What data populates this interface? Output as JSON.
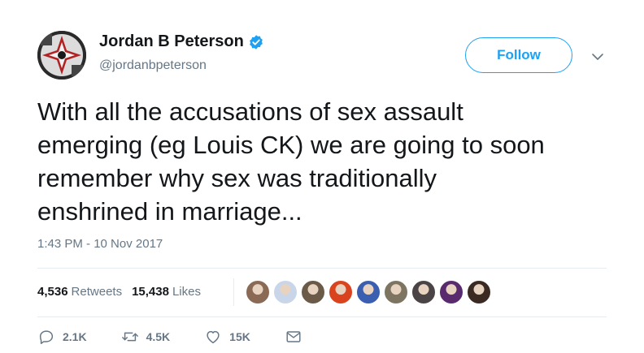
{
  "author": {
    "name": "Jordan B Peterson",
    "handle": "@jordanbpeterson",
    "verified": true,
    "avatar_icon": "mandala-avatar"
  },
  "follow_label": "Follow",
  "tweet": {
    "text": "With all the accusations of sex assault\nemerging (eg Louis CK) we are going to soon\nremember why sex was traditionally\nenshrined in marriage...",
    "timestamp": "1:43 PM - 10 Nov 2017"
  },
  "stats": {
    "retweets_count": "4,536",
    "retweets_label": "Retweets",
    "likes_count": "15,438",
    "likes_label": "Likes"
  },
  "likers": [
    {
      "name": "liker-1",
      "color": "#8a6a55"
    },
    {
      "name": "liker-2",
      "color": "#c9d6ea"
    },
    {
      "name": "liker-3",
      "color": "#6b5a48"
    },
    {
      "name": "liker-4",
      "color": "#d9431e"
    },
    {
      "name": "liker-5",
      "color": "#3a5fb0"
    },
    {
      "name": "liker-6",
      "color": "#7d7462"
    },
    {
      "name": "liker-7",
      "color": "#4a4446"
    },
    {
      "name": "liker-8",
      "color": "#5a2a6e"
    },
    {
      "name": "liker-9",
      "color": "#3b2a22"
    }
  ],
  "actions": {
    "reply_count": "2.1K",
    "retweet_count": "4.5K",
    "like_count": "15K"
  },
  "colors": {
    "accent": "#1da1f2",
    "text": "#14171a",
    "secondary": "#657786",
    "border": "#e6ecf0"
  }
}
